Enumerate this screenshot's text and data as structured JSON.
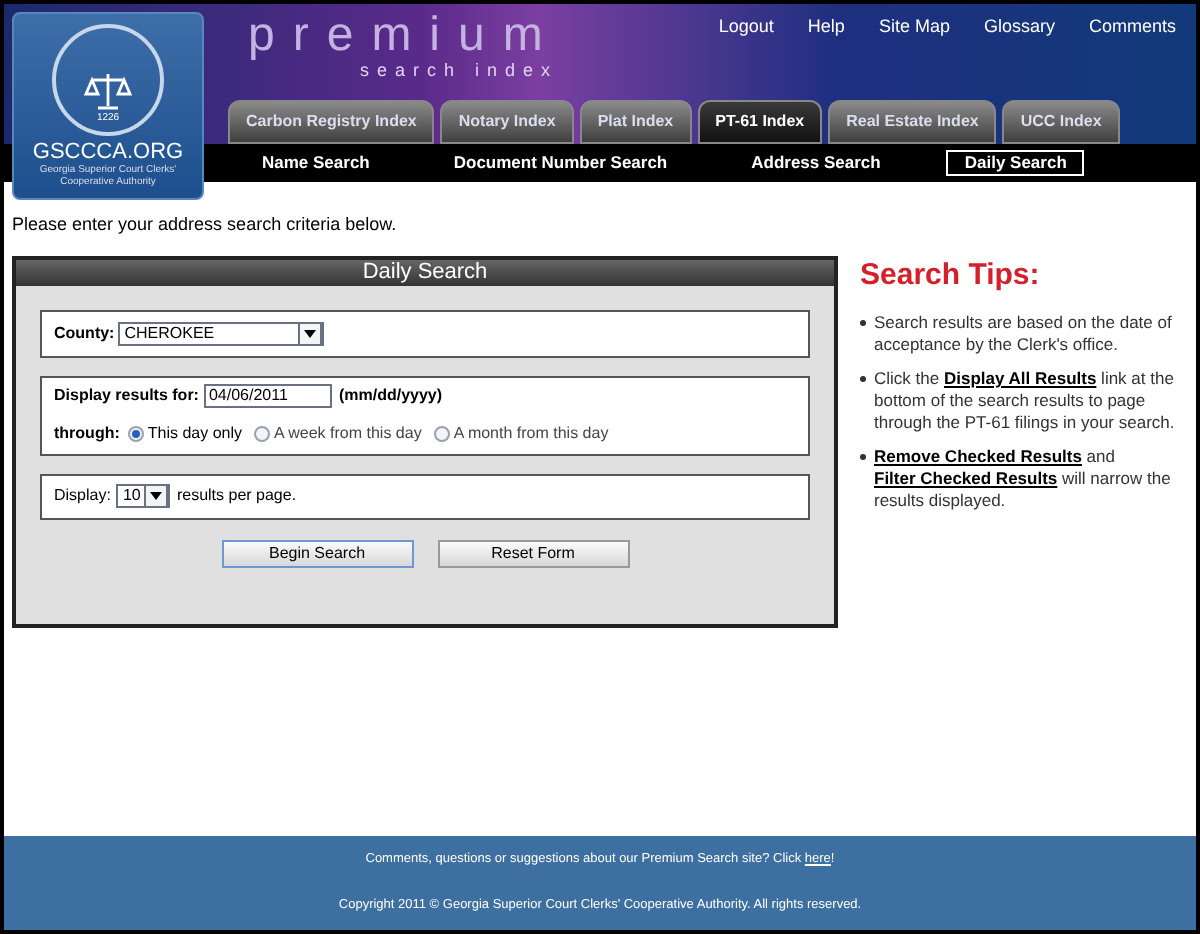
{
  "logo": {
    "title": "GSCCCA.ORG",
    "subtitle": "Georgia Superior Court Clerks' Cooperative Authority",
    "seal_year": "1226"
  },
  "banner": {
    "title": "premium",
    "subtitle": "search index"
  },
  "top_links": [
    "Logout",
    "Help",
    "Site Map",
    "Glossary",
    "Comments"
  ],
  "tabs": [
    {
      "label": "Carbon Registry Index",
      "selected": false
    },
    {
      "label": "Notary Index",
      "selected": false
    },
    {
      "label": "Plat Index",
      "selected": false
    },
    {
      "label": "PT-61 Index",
      "selected": true
    },
    {
      "label": "Real Estate Index",
      "selected": false
    },
    {
      "label": "UCC Index",
      "selected": false
    }
  ],
  "subtabs": [
    {
      "label": "Name Search",
      "selected": false
    },
    {
      "label": "Document Number Search",
      "selected": false
    },
    {
      "label": "Address Search",
      "selected": false
    },
    {
      "label": "Daily Search",
      "selected": true
    }
  ],
  "intro": "Please enter your address search criteria below.",
  "panel": {
    "title": "Daily Search",
    "county": {
      "label": "County:",
      "value": "CHEROKEE"
    },
    "date": {
      "label": "Display results for:",
      "value": "04/06/2011",
      "hint": "(mm/dd/yyyy)"
    },
    "through": {
      "label": "through:",
      "options": [
        {
          "label": "This day only",
          "selected": true
        },
        {
          "label": "A week from this day",
          "selected": false
        },
        {
          "label": "A month from this day",
          "selected": false
        }
      ]
    },
    "display": {
      "label": "Display:",
      "value": "10",
      "suffix": "results per page."
    },
    "buttons": [
      "Begin Search",
      "Reset Form"
    ]
  },
  "tips": {
    "title": "Search Tips:",
    "items": [
      [
        {
          "text": "Search results are based on the date of acceptance by the Clerk's office.",
          "link": false
        }
      ],
      [
        {
          "text": "Click the ",
          "link": false
        },
        {
          "text": "Display All Results",
          "link": true
        },
        {
          "text": " link at the bottom of the search results to page through the PT-61 filings in your search.",
          "link": false
        }
      ],
      [
        {
          "text": "Remove Checked Results",
          "link": true
        },
        {
          "text": " and ",
          "link": false
        },
        {
          "text": "Filter Checked Results",
          "link": true
        },
        {
          "text": " will narrow the results displayed.",
          "link": false
        }
      ]
    ]
  },
  "footer": {
    "comment": {
      "before": "Comments, questions or suggestions about our Premium Search site? Click ",
      "link": "here",
      "after": "!"
    },
    "copyright": "Copyright 2011 © Georgia Superior Court Clerks' Cooperative Authority. All rights reserved."
  }
}
